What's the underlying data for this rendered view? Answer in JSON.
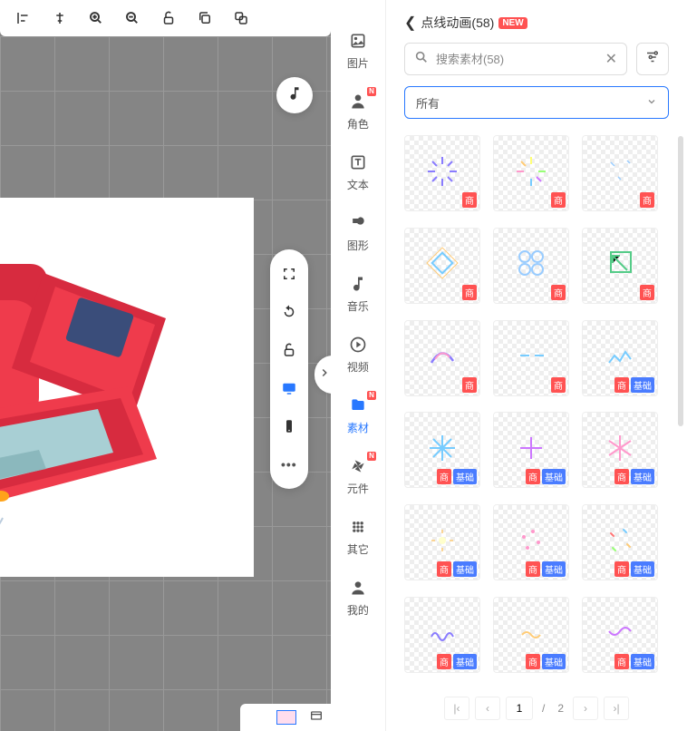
{
  "toolbar": {
    "align_left": "align-left",
    "align_center": "align-center",
    "zoom_in": "zoom-in",
    "zoom_out": "zoom-out",
    "lock": "lock",
    "copy": "copy",
    "layers": "layers"
  },
  "nav": {
    "items": [
      {
        "id": "image",
        "label": "图片",
        "icon": "image-icon",
        "new": false
      },
      {
        "id": "character",
        "label": "角色",
        "icon": "person-icon",
        "new": true
      },
      {
        "id": "text",
        "label": "文本",
        "icon": "text-icon",
        "new": false
      },
      {
        "id": "shape",
        "label": "图形",
        "icon": "shape-icon",
        "new": false
      },
      {
        "id": "music",
        "label": "音乐",
        "icon": "music-note-icon",
        "new": false
      },
      {
        "id": "video",
        "label": "视频",
        "icon": "play-icon",
        "new": false
      },
      {
        "id": "material",
        "label": "素材",
        "icon": "folder-icon",
        "new": true,
        "active": true
      },
      {
        "id": "component",
        "label": "元件",
        "icon": "pinwheel-icon",
        "new": true
      },
      {
        "id": "other",
        "label": "其它",
        "icon": "grid-icon",
        "new": false
      },
      {
        "id": "mine",
        "label": "我的",
        "icon": "user-icon",
        "new": false
      }
    ]
  },
  "panel": {
    "title": "点线动画(58)",
    "new_label": "NEW",
    "search_placeholder": "搜索素材(58)",
    "filter_label": "所有"
  },
  "badges": {
    "shang": "商",
    "jichu": "基础"
  },
  "assets": [
    {
      "tags": [
        "shang"
      ],
      "kind": "burst"
    },
    {
      "tags": [
        "shang"
      ],
      "kind": "burst2"
    },
    {
      "tags": [
        "shang"
      ],
      "kind": "sparkle"
    },
    {
      "tags": [
        "shang"
      ],
      "kind": "diamond"
    },
    {
      "tags": [
        "shang"
      ],
      "kind": "flower"
    },
    {
      "tags": [
        "shang"
      ],
      "kind": "arrow"
    },
    {
      "tags": [
        "shang"
      ],
      "kind": "swish"
    },
    {
      "tags": [
        "shang"
      ],
      "kind": "dash"
    },
    {
      "tags": [
        "shang",
        "jichu"
      ],
      "kind": "zig"
    },
    {
      "tags": [
        "shang",
        "jichu"
      ],
      "kind": "star"
    },
    {
      "tags": [
        "shang",
        "jichu"
      ],
      "kind": "plus"
    },
    {
      "tags": [
        "shang",
        "jichu"
      ],
      "kind": "rays"
    },
    {
      "tags": [
        "shang",
        "jichu"
      ],
      "kind": "glow"
    },
    {
      "tags": [
        "shang",
        "jichu"
      ],
      "kind": "dots"
    },
    {
      "tags": [
        "shang",
        "jichu"
      ],
      "kind": "confetti"
    },
    {
      "tags": [
        "shang",
        "jichu"
      ],
      "kind": "wave"
    },
    {
      "tags": [
        "shang",
        "jichu"
      ],
      "kind": "wave2"
    },
    {
      "tags": [
        "shang",
        "jichu"
      ],
      "kind": "wave3"
    }
  ],
  "pagination": {
    "current": "1",
    "sep": "/",
    "total": "2"
  }
}
